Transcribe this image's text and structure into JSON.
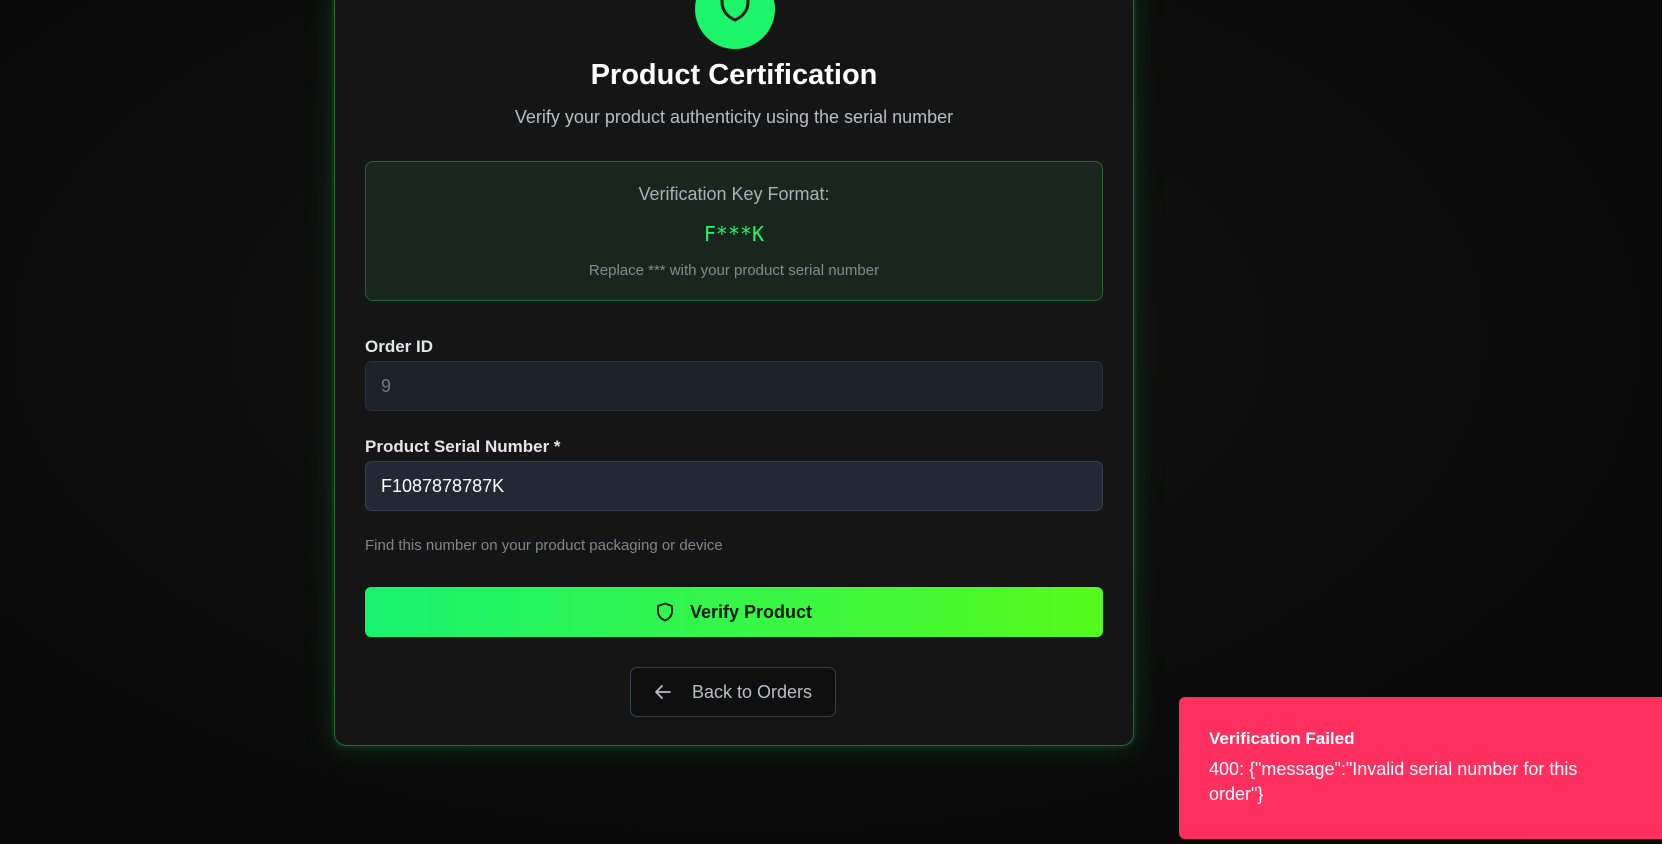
{
  "card": {
    "title": "Product Certification",
    "subtitle": "Verify your product authenticity using the serial number",
    "logo_icon": "shield-icon"
  },
  "key_format": {
    "label": "Verification Key Format:",
    "value": "F***K",
    "hint": "Replace *** with your product serial number"
  },
  "form": {
    "order_id": {
      "label": "Order ID",
      "value": "9"
    },
    "serial": {
      "label": "Product Serial Number *",
      "value": "F1087878787K",
      "help": "Find this number on your product packaging or device"
    },
    "verify_button": {
      "label": "Verify Product",
      "icon": "shield-icon"
    },
    "back_button": {
      "label": "Back to Orders",
      "icon": "arrow-left-icon"
    }
  },
  "toast": {
    "title": "Verification Failed",
    "message": "400: {\"message\":\"Invalid serial number for this order\"}"
  },
  "colors": {
    "accent": "#1cf46a",
    "error": "#ff2f5f"
  }
}
